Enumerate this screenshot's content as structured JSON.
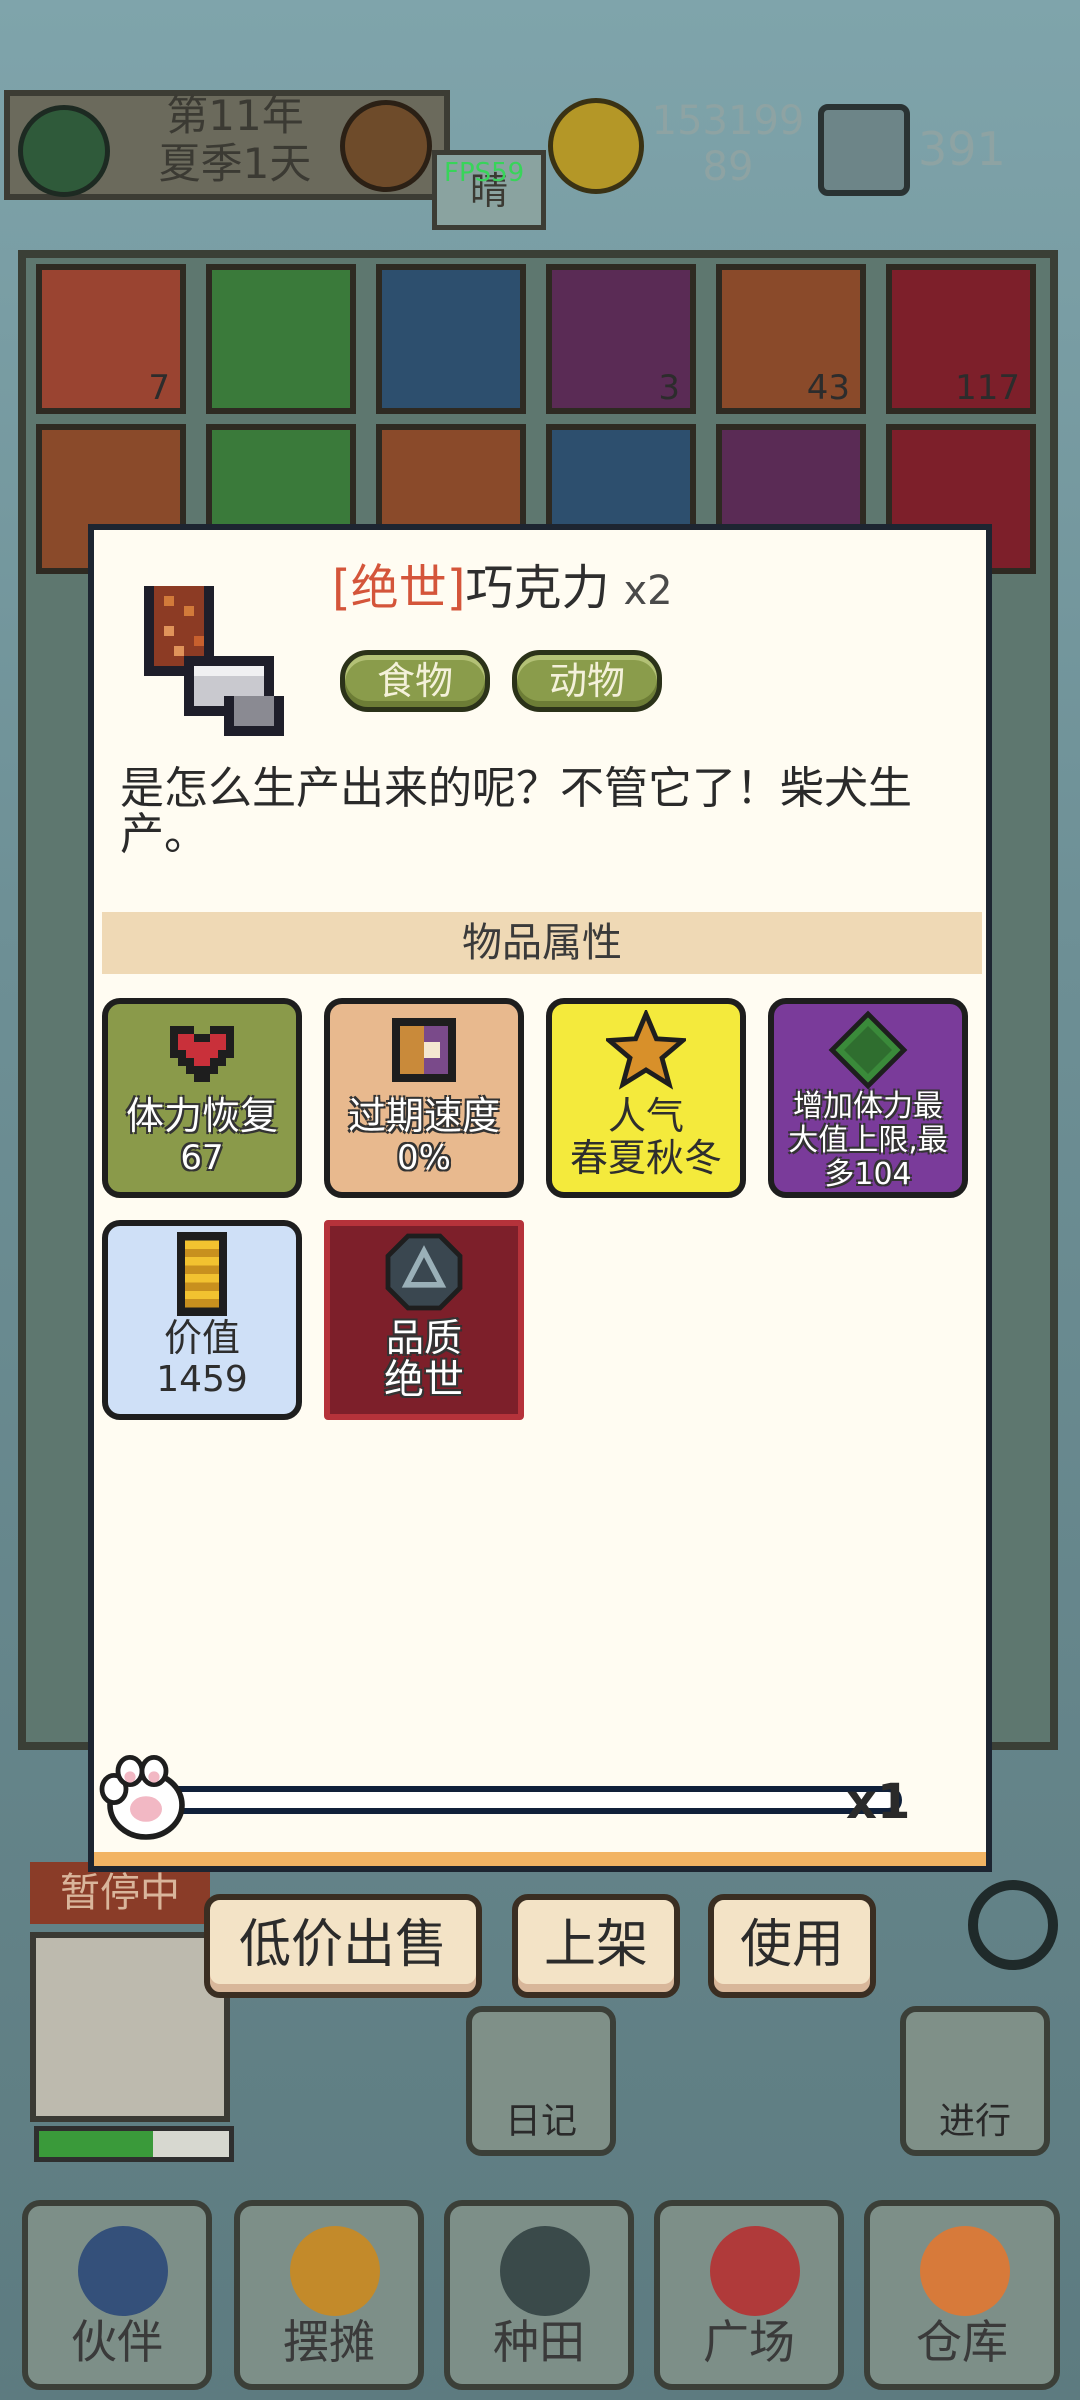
{
  "hud": {
    "date_year": "第11年",
    "date_day": "夏季1天",
    "weather": "晴",
    "fps": "FPS59",
    "coins": "153199",
    "coins_sub": "89",
    "gems": "391"
  },
  "grid_counts": [
    "7",
    "3",
    "43",
    "117"
  ],
  "item": {
    "rarity": "[绝世]",
    "name": "巧克力",
    "quantity": "x2",
    "tags": [
      "食物",
      "动物"
    ],
    "description": "是怎么生产出来的呢？不管它了！柴犬生产。"
  },
  "attributes": {
    "section_title": "物品属性",
    "list": [
      {
        "label": "体力恢复",
        "value": "67",
        "icon": "heart-icon",
        "bg": "#8a9a4a"
      },
      {
        "label": "过期速度",
        "value": "0%",
        "icon": "clock-icon",
        "bg": "#e8b98e"
      },
      {
        "label": "人气",
        "value": "春夏秋冬",
        "icon": "star-icon",
        "bg": "#f4ea3c"
      },
      {
        "label": "增加体力最大值上限,最多104",
        "value": "",
        "icon": "diamond-icon",
        "bg": "#7a3b9a"
      },
      {
        "label": "价值",
        "value": "1459",
        "icon": "coin-stack-icon",
        "bg": "#cfe0f7"
      },
      {
        "label": "品质",
        "value": "绝世",
        "icon": "quality-badge-icon",
        "bg": "#7d1f2a"
      }
    ]
  },
  "slider": {
    "multiplier": "x1",
    "level": 0
  },
  "actions": {
    "sell_cheap": "低价出售",
    "list": "上架",
    "use": "使用"
  },
  "status": {
    "paused": "暂停中"
  },
  "side": {
    "diary": "日记",
    "proceed": "进行"
  },
  "nav": [
    "伙伴",
    "摆摊",
    "种田",
    "广场",
    "仓库"
  ],
  "colors": {
    "rarity": "#d4553a",
    "tag_green": "#8a9c4b",
    "section_bar": "#efd9b5",
    "modal_bg": "#fffcf2"
  }
}
